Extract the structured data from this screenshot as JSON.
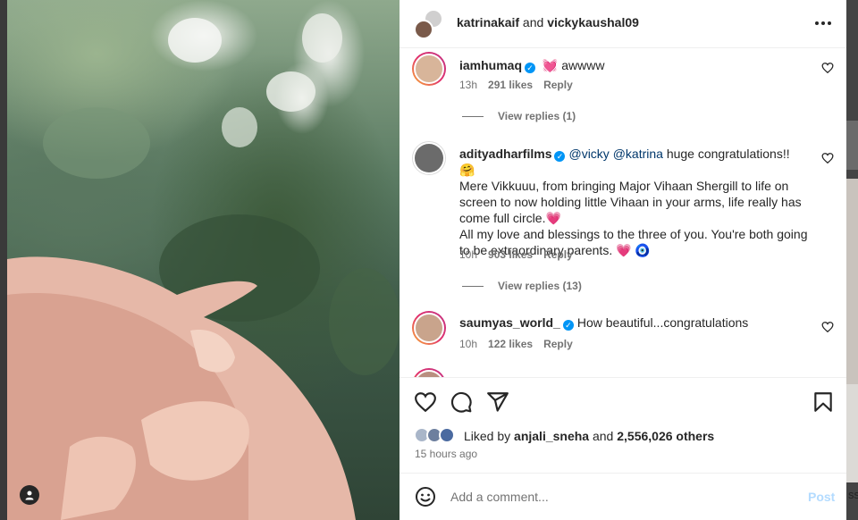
{
  "post": {
    "authors_primary": "katrinakaif",
    "authors_connector": " and ",
    "authors_secondary": "vickykaushal09",
    "more_icon": "more-horizontal-icon"
  },
  "comments": [
    {
      "username": "iamhumaq",
      "verified": true,
      "text": "awwww",
      "emoji": "💓",
      "time": "13h",
      "likes": "291 likes",
      "reply_label": "Reply",
      "view_replies": "View replies (1)"
    },
    {
      "username": "adityadharfilms",
      "verified": true,
      "mention1": "@vicky",
      "mention2": "@katrina",
      "text_part1": " huge congratulations!! 🤗",
      "text_line2": "Mere Vikkuuu, from bringing Major Vihaan Shergill to life on screen to now holding little Vihaan in your arms, life really has come full circle.💗",
      "text_line3": "All my love and blessings to the three of you. You're both going to be extraordinary parents. 💗 🧿",
      "time": "10h",
      "likes": "903 likes",
      "reply_label": "Reply",
      "view_replies": "View replies (13)"
    },
    {
      "username": "saumyas_world_",
      "verified": true,
      "text": "How beautiful...congratulations",
      "time": "10h",
      "likes": "122 likes",
      "reply_label": "Reply"
    }
  ],
  "likes_row": {
    "prefix": "Liked by ",
    "liker": "anjali_sneha",
    "connector": " and ",
    "others": "2,556,026 others"
  },
  "timestamp": "15 hours ago",
  "comment_box": {
    "placeholder": "Add a comment...",
    "post_label": "Post"
  },
  "backdrop_text": "ss",
  "colors": {
    "accent": "#0095f6",
    "post_disabled": "#b3dbff",
    "muted": "#737373"
  }
}
